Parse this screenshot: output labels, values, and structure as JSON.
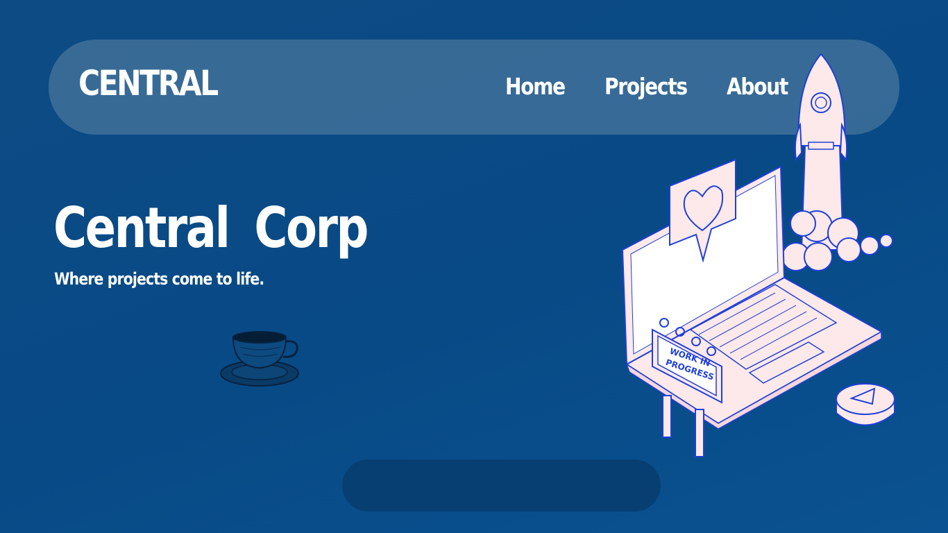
{
  "brand": "CENTRAL",
  "nav": {
    "home": "Home",
    "projects": "Projects",
    "about": "About"
  },
  "hero": {
    "title": "Central Corp",
    "subtitle": "Where projects come to life."
  },
  "illustration": {
    "sign_line1": "WORK IN",
    "sign_line2": "PROGRESS",
    "icons": [
      "rocket-icon",
      "laptop-icon",
      "heart-speech-bubble-icon",
      "play-button-icon",
      "coffee-cup-icon"
    ]
  },
  "colors": {
    "background": "#0b4c87",
    "navbar": "#5a80a4",
    "accent_outline": "#1f3fd8",
    "illustration_fill": "#fde9ea",
    "bottom_pill": "#073f72"
  }
}
